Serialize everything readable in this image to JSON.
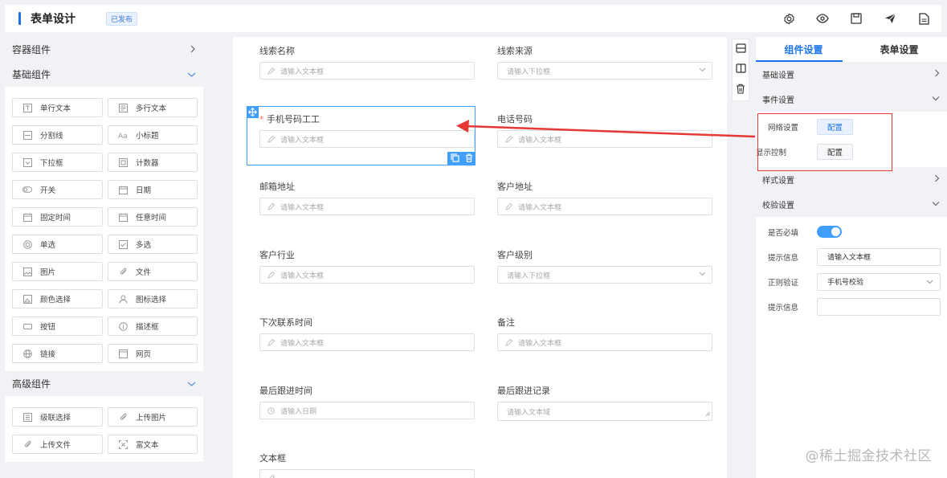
{
  "header": {
    "title": "表单设计",
    "badge": "已发布",
    "tools": [
      "settings-icon",
      "eye-icon",
      "save-icon",
      "send-icon",
      "document-icon"
    ]
  },
  "left": {
    "container_section": "容器组件",
    "basic_section": "基础组件",
    "advanced_section": "高级组件",
    "basic_items": [
      {
        "label": "单行文本",
        "icon": "text-input-icon"
      },
      {
        "label": "多行文本",
        "icon": "textarea-icon"
      },
      {
        "label": "分割线",
        "icon": "divider-icon"
      },
      {
        "label": "小标题",
        "icon": "subtitle-icon"
      },
      {
        "label": "下拉框",
        "icon": "dropdown-icon"
      },
      {
        "label": "计数器",
        "icon": "counter-icon"
      },
      {
        "label": "开关",
        "icon": "toggle-icon"
      },
      {
        "label": "日期",
        "icon": "calendar-icon"
      },
      {
        "label": "固定时间",
        "icon": "calendar-icon"
      },
      {
        "label": "任意时间",
        "icon": "calendar-icon"
      },
      {
        "label": "单选",
        "icon": "radio-icon"
      },
      {
        "label": "多选",
        "icon": "checkbox-icon"
      },
      {
        "label": "图片",
        "icon": "image-icon"
      },
      {
        "label": "文件",
        "icon": "paperclip-icon"
      },
      {
        "label": "颜色选择",
        "icon": "color-icon"
      },
      {
        "label": "图标选择",
        "icon": "user-icon"
      },
      {
        "label": "按钮",
        "icon": "button-icon"
      },
      {
        "label": "描述框",
        "icon": "info-icon"
      },
      {
        "label": "链接",
        "icon": "globe-icon"
      },
      {
        "label": "网页",
        "icon": "webpage-icon"
      }
    ],
    "advanced_items": [
      {
        "label": "级联选择",
        "icon": "cascade-icon"
      },
      {
        "label": "上传图片",
        "icon": "paperclip-icon"
      },
      {
        "label": "上传文件",
        "icon": "paperclip-icon"
      },
      {
        "label": "富文本",
        "icon": "richtext-icon"
      }
    ]
  },
  "canvas": {
    "fields": [
      {
        "label": "线索名称",
        "placeholder": "请输入文本框",
        "kind": "text"
      },
      {
        "label": "线索来源",
        "placeholder": "请输入下拉框",
        "kind": "select"
      },
      {
        "label": "手机号码工工",
        "placeholder": "请输入文本框",
        "kind": "text",
        "required": "*"
      },
      {
        "label": "电话号码",
        "placeholder": "请输入文本框",
        "kind": "text"
      },
      {
        "label": "邮箱地址",
        "placeholder": "请输入文本框",
        "kind": "text"
      },
      {
        "label": "客户地址",
        "placeholder": "请输入文本框",
        "kind": "text"
      },
      {
        "label": "客户行业",
        "placeholder": "请输入文本框",
        "kind": "text"
      },
      {
        "label": "客户级别",
        "placeholder": "请输入下拉框",
        "kind": "select"
      },
      {
        "label": "下次联系时间",
        "placeholder": "请输入文本框",
        "kind": "text"
      },
      {
        "label": "备注",
        "placeholder": "请输入文本框",
        "kind": "text"
      },
      {
        "label": "最后跟进时间",
        "placeholder": "请输入日期",
        "kind": "date"
      },
      {
        "label": "最后跟进记录",
        "placeholder": "请输入文本域",
        "kind": "textarea"
      },
      {
        "label": "文本框",
        "placeholder": "",
        "kind": "text"
      }
    ]
  },
  "right": {
    "tabs": [
      "组件设置",
      "表单设置"
    ],
    "sections": {
      "basic": "基础设置",
      "event": "事件设置",
      "style": "样式设置",
      "validation": "校验设置"
    },
    "event_rows": [
      {
        "label": "网络设置",
        "button": "配置"
      },
      {
        "label": "显示控制",
        "button": "配置"
      }
    ],
    "validation": {
      "required_label": "是否必填",
      "required_on": true,
      "hint_label": "提示信息",
      "hint_value": "请输入文本框",
      "regex_label": "正则验证",
      "regex_value": "手机号校验",
      "hint2_label": "提示信息",
      "hint2_value": ""
    }
  },
  "watermark": "@稀土掘金技术社区",
  "colors": {
    "accent": "#409eff",
    "brand": "#1a73e8",
    "annotation": "#e53935"
  }
}
